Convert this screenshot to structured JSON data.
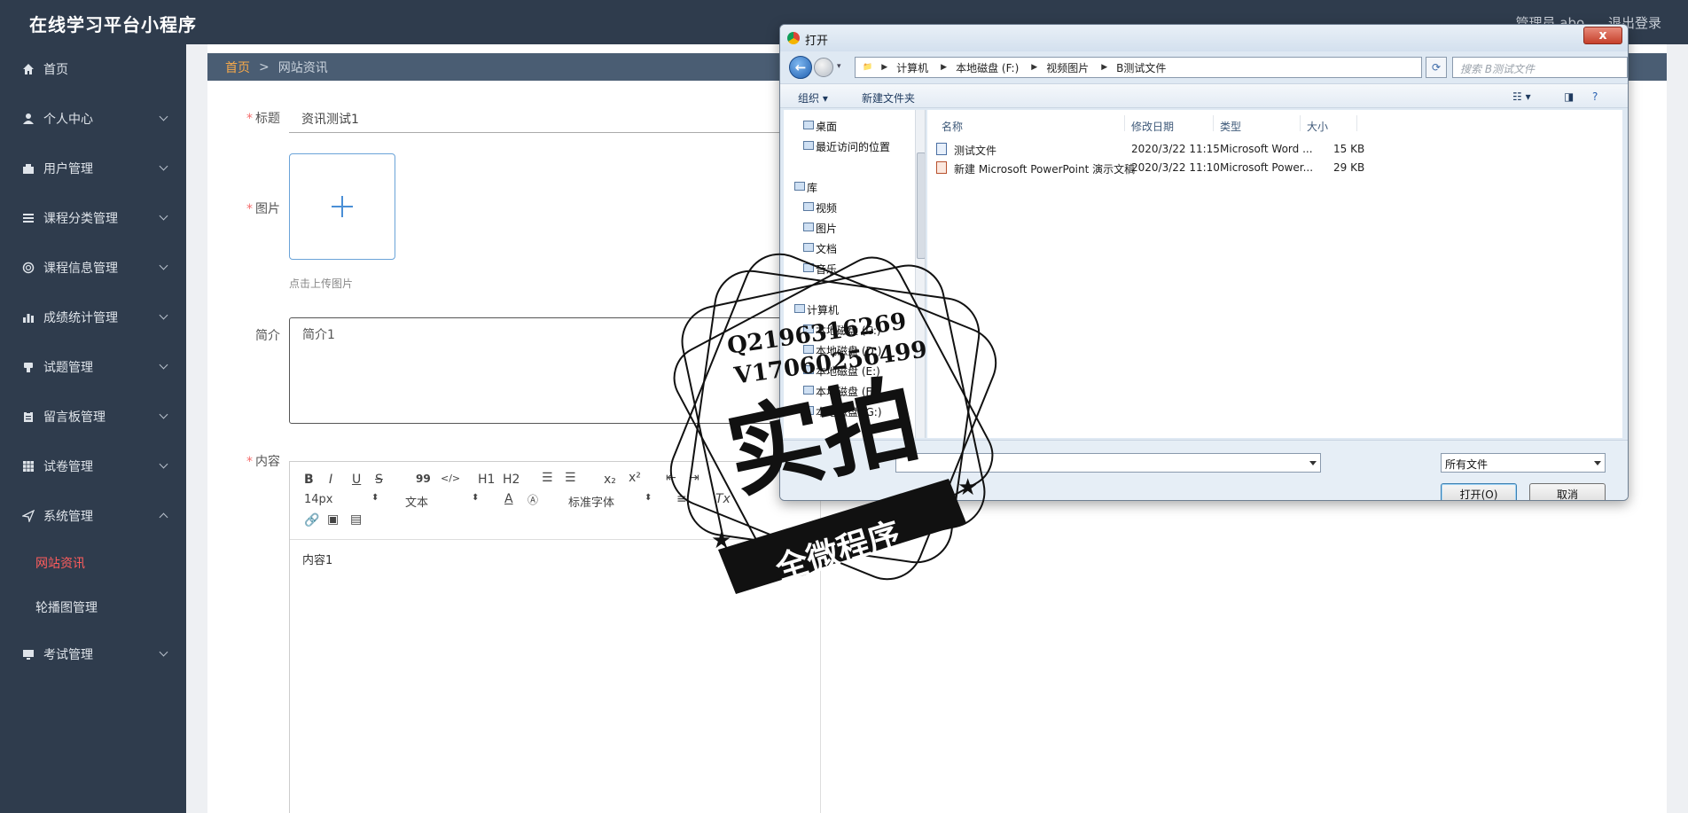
{
  "app": {
    "title": "在线学习平台小程序",
    "user": "管理员 abo",
    "logout": "退出登录"
  },
  "sidebar": {
    "items": [
      {
        "label": "首页",
        "icon": "home-icon"
      },
      {
        "label": "个人中心",
        "icon": "user-icon"
      },
      {
        "label": "用户管理",
        "icon": "users-icon"
      },
      {
        "label": "课程分类管理",
        "icon": "list-icon"
      },
      {
        "label": "课程信息管理",
        "icon": "circle-icon"
      },
      {
        "label": "成绩统计管理",
        "icon": "bar-chart-icon"
      },
      {
        "label": "试题管理",
        "icon": "thumb-icon"
      },
      {
        "label": "留言板管理",
        "icon": "clipboard-icon"
      },
      {
        "label": "试卷管理",
        "icon": "grid-icon"
      },
      {
        "label": "系统管理",
        "icon": "send-icon"
      }
    ],
    "sub_items": [
      {
        "label": "网站资讯"
      },
      {
        "label": "轮播图管理"
      }
    ],
    "last_item": {
      "label": "考试管理",
      "icon": "monitor-icon"
    }
  },
  "breadcrumb": {
    "home": "首页",
    "sep": ">",
    "current": "网站资讯"
  },
  "form": {
    "title_label": "标题",
    "title_value": "资讯测试1",
    "image_label": "图片",
    "upload_hint": "点击上传图片",
    "intro_label": "简介",
    "intro_value": "简介1",
    "content_label": "内容",
    "content_value": "内容1"
  },
  "editor": {
    "font_size": "14px",
    "text_style": "文本",
    "font_family": "标准字体",
    "buttons": [
      "B",
      "I",
      "U",
      "S",
      "99",
      "</>",
      "H1",
      "H2"
    ]
  },
  "dialog": {
    "title": "打开",
    "close": "x",
    "path": [
      "计算机",
      "本地磁盘 (F:)",
      "视频图片",
      "B测试文件"
    ],
    "search_placeholder": "搜索 B测试文件",
    "organize": "组织 ▾",
    "new_folder": "新建文件夹",
    "nav": {
      "desktop": "桌面",
      "recent": "最近访问的位置",
      "library": "库",
      "video": "视频",
      "pictures": "图片",
      "documents": "文档",
      "music": "音乐",
      "computer": "计算机",
      "disk_c": "本地磁盘 (C:)",
      "disk_d": "本地磁盘 (D:)",
      "disk_e": "本地磁盘 (E:)",
      "disk_f": "本地磁盘 (F:)",
      "disk_g": "本地磁盘 (G:)"
    },
    "columns": [
      "名称",
      "修改日期",
      "类型",
      "大小"
    ],
    "files": [
      {
        "name": "测试文件",
        "date": "2020/3/22 11:15",
        "type": "Microsoft Word ...",
        "size": "15 KB"
      },
      {
        "name": "新建 Microsoft PowerPoint 演示文稿",
        "date": "2020/3/22 11:10",
        "type": "Microsoft Power...",
        "size": "29 KB"
      }
    ],
    "file_type": "所有文件",
    "open_btn": "打开(O)",
    "cancel_btn": "取消"
  },
  "watermark": {
    "line1": "Q2196316269",
    "line2": "V17060256499",
    "main": "实拍",
    "banner": "全微程序"
  }
}
